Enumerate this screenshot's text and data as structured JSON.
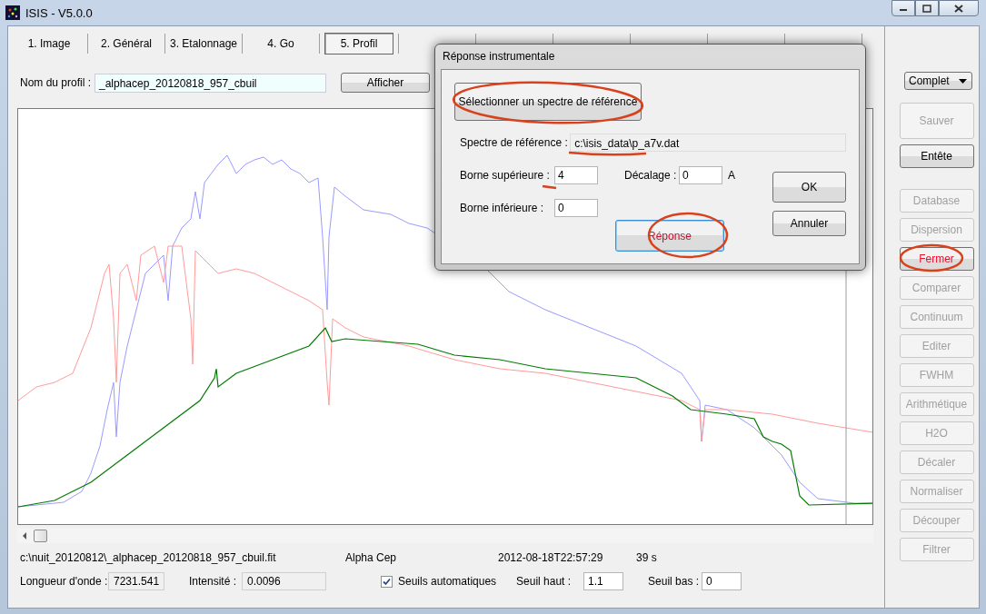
{
  "window": {
    "title": "ISIS - V5.0.0"
  },
  "tabs": [
    {
      "label": "1. Image",
      "selected": false
    },
    {
      "label": "2. Général",
      "selected": false
    },
    {
      "label": "3. Etalonnage",
      "selected": false
    },
    {
      "label": "4. Go",
      "selected": false
    },
    {
      "label": "5. Profil",
      "selected": true
    }
  ],
  "profile": {
    "label": "Nom du profil :",
    "value": "_alphacep_20120818_957_cbuil",
    "button": "Afficher"
  },
  "view_select": {
    "value": "Complet"
  },
  "file_buttons": [
    {
      "label": "Sauver",
      "disabled": true,
      "highlighted": false
    },
    {
      "label": "Entête",
      "disabled": false,
      "highlighted": false
    }
  ],
  "tool_buttons": [
    {
      "label": "Database",
      "disabled": true,
      "highlighted": false
    },
    {
      "label": "Dispersion",
      "disabled": true,
      "highlighted": false
    },
    {
      "label": "Fermer",
      "disabled": false,
      "highlighted": true
    },
    {
      "label": "Comparer",
      "disabled": true,
      "highlighted": false
    },
    {
      "label": "Continuum",
      "disabled": true,
      "highlighted": false
    },
    {
      "label": "Editer",
      "disabled": true,
      "highlighted": false
    },
    {
      "label": "FWHM",
      "disabled": true,
      "highlighted": false
    },
    {
      "label": "Arithmétique",
      "disabled": true,
      "highlighted": false
    },
    {
      "label": "H2O",
      "disabled": true,
      "highlighted": false
    },
    {
      "label": "Décaler",
      "disabled": true,
      "highlighted": false
    },
    {
      "label": "Normaliser",
      "disabled": true,
      "highlighted": false
    },
    {
      "label": "Découper",
      "disabled": true,
      "highlighted": false
    },
    {
      "label": "Filtrer",
      "disabled": true,
      "highlighted": false
    }
  ],
  "file_info": {
    "path": "c:\\nuit_20120812\\_alphacep_20120818_957_cbuil.fit",
    "object": "Alpha Cep",
    "date": "2012-08-18T22:57:29",
    "exposure": "39 s"
  },
  "readouts": [
    {
      "label": "Longueur d'onde :",
      "value": "7231.541"
    },
    {
      "label": "Intensité :",
      "value": "0.0096"
    }
  ],
  "auto_threshold": {
    "label": "Seuils automatiques",
    "checked": true
  },
  "thresholds": [
    {
      "label": "Seuil haut :",
      "value": "1.1"
    },
    {
      "label": "Seuil bas :",
      "value": "0"
    }
  ],
  "dialog": {
    "title": "Réponse instrumentale",
    "select_button": "Sélectionner un spectre de référence",
    "reference": {
      "label": "Spectre de référence :",
      "value": "c:\\isis_data\\p_a7v.dat"
    },
    "upper": {
      "label": "Borne supérieure :",
      "value": "4"
    },
    "shift": {
      "label": "Décalage :",
      "value": "0",
      "unit": "A"
    },
    "lower": {
      "label": "Borne inférieure :",
      "value": "0"
    },
    "buttons": [
      {
        "label": "Réponse",
        "focused": true,
        "highlighted": true
      },
      {
        "label": "OK",
        "focused": false,
        "highlighted": false
      },
      {
        "label": "Annuler",
        "focused": false,
        "highlighted": false
      }
    ]
  }
}
